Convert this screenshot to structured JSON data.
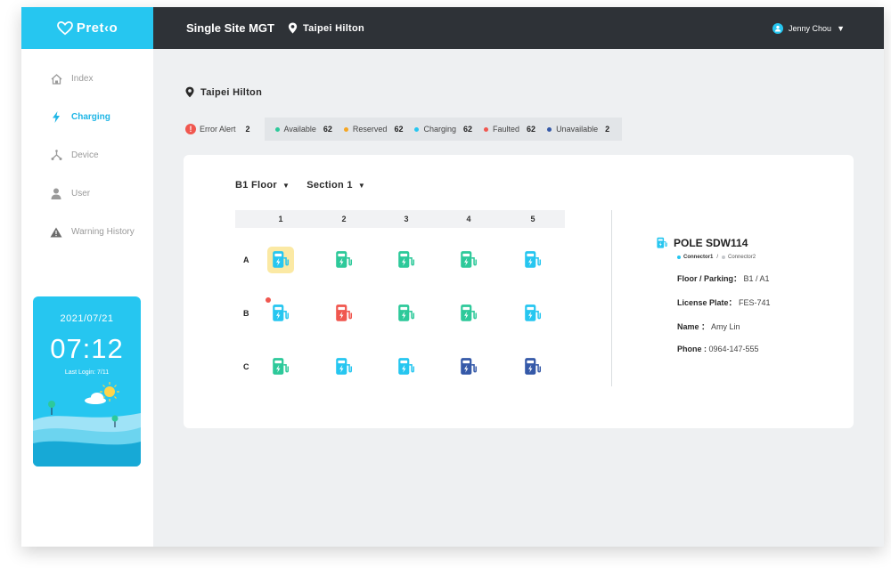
{
  "app": {
    "brand": "Pret‹o",
    "title": "Single Site MGT",
    "site": "Taipei Hilton"
  },
  "user": {
    "name": "Jenny Chou",
    "caret": "▼"
  },
  "sidebar": {
    "items": [
      {
        "label": "Index",
        "icon": "home-icon",
        "active": false
      },
      {
        "label": "Charging",
        "icon": "lightning-icon",
        "active": true
      },
      {
        "label": "Device",
        "icon": "device-icon",
        "active": false
      },
      {
        "label": "User",
        "icon": "user-icon",
        "active": false
      },
      {
        "label": "Warning History",
        "icon": "warning-icon",
        "active": false
      }
    ]
  },
  "time_card": {
    "date": "2021/07/21",
    "time": "07:12",
    "last_login": "Last Login: 7/11"
  },
  "page": {
    "heading": "Taipei Hilton"
  },
  "status": {
    "error_label": "Error Alert",
    "error_count": "2",
    "legend": [
      {
        "label": "Available",
        "count": "62",
        "color": "#2dc99a"
      },
      {
        "label": "Reserved",
        "count": "62",
        "color": "#f5a623"
      },
      {
        "label": "Charging",
        "count": "62",
        "color": "#26c6f0"
      },
      {
        "label": "Faulted",
        "count": "62",
        "color": "#f0574f"
      },
      {
        "label": "Unavailable",
        "count": "2",
        "color": "#3559a8"
      }
    ]
  },
  "filters": {
    "floor": "B1 Floor",
    "section": "Section 1",
    "caret": "▼"
  },
  "grid": {
    "columns": [
      "1",
      "2",
      "3",
      "4",
      "5"
    ],
    "rows": [
      {
        "label": "A",
        "slots": [
          "charging",
          "available",
          "available",
          "available",
          "charging"
        ]
      },
      {
        "label": "B",
        "slots": [
          "charging",
          "faulted",
          "available",
          "available",
          "charging"
        ]
      },
      {
        "label": "C",
        "slots": [
          "available",
          "charging",
          "charging",
          "unavailable",
          "unavailable"
        ]
      }
    ],
    "selected": {
      "row": 0,
      "col": 0
    },
    "error_slot": {
      "row": 1,
      "col": 0
    }
  },
  "colors": {
    "charging": "#26c6f0",
    "available": "#2dc99a",
    "faulted": "#f0574f",
    "unavailable": "#3559a8",
    "reserved": "#f5a623",
    "accent": "#26c6f0",
    "topbar": "#2e3237"
  },
  "detail": {
    "pole": "POLE SDW114",
    "connector1": "Connector1",
    "connector_sep": "/",
    "connector2": "Connector2",
    "floor_label": "Floor / Parking：",
    "floor_value": "B1 / A1",
    "plate_label": "License Plate：",
    "plate_value": "FES-741",
    "name_label": "Name ：",
    "name_value": "Amy Lin",
    "phone_label": "Phone :",
    "phone_value": "0964-147-555"
  }
}
